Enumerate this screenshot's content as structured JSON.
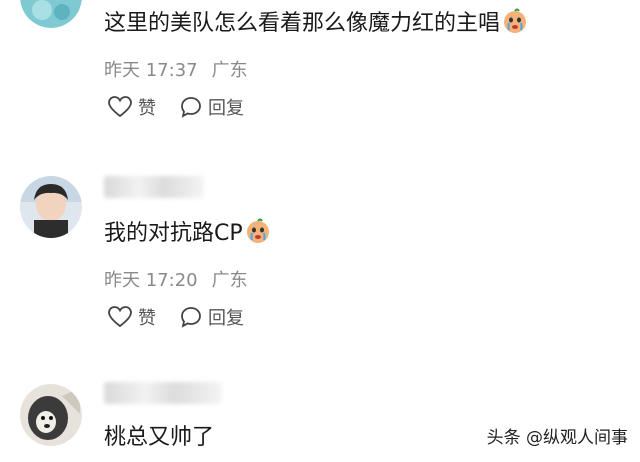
{
  "comments": [
    {
      "text": "这里的美队怎么看着那么像魔力红的主唱",
      "emoji_icon": "crying-face-icon",
      "time": "昨天 17:37",
      "location": "广东",
      "like_label": "赞",
      "reply_label": "回复"
    },
    {
      "text": "我的对抗路CP",
      "emoji_icon": "crying-face-icon",
      "time": "昨天 17:20",
      "location": "广东",
      "like_label": "赞",
      "reply_label": "回复"
    },
    {
      "text": "桃总又帅了"
    }
  ],
  "watermark": "头条 @纵观人间事",
  "colors": {
    "text": "#1a1a1a",
    "meta": "#8a8a8a",
    "background": "#ffffff"
  }
}
